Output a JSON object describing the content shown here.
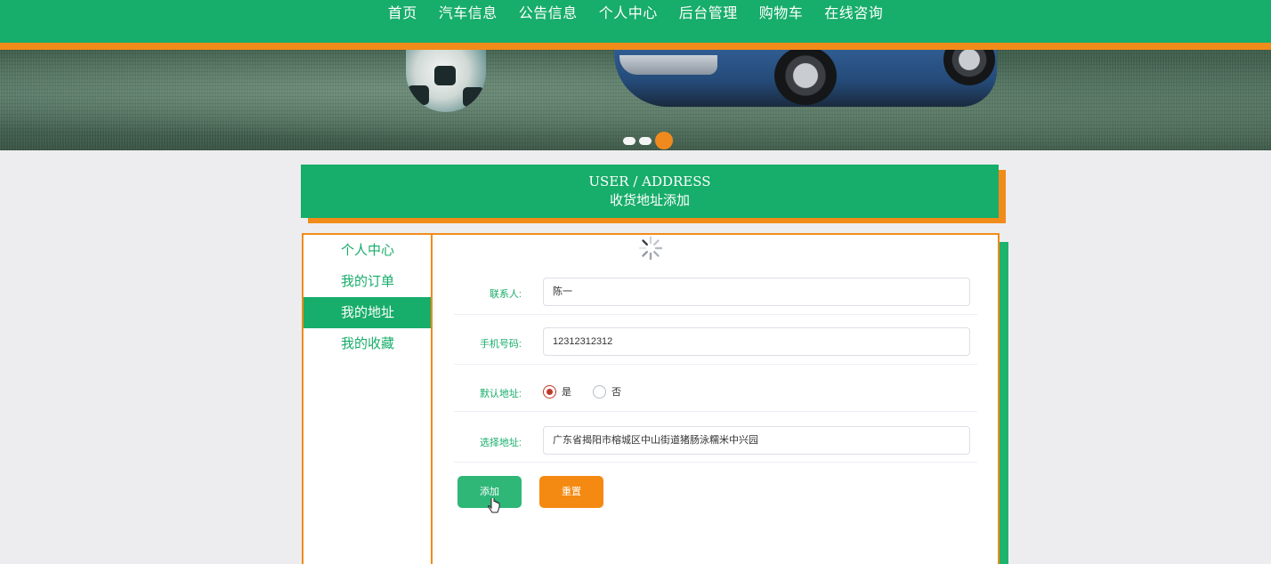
{
  "nav": {
    "items": [
      "首页",
      "汽车信息",
      "公告信息",
      "个人中心",
      "后台管理",
      "购物车",
      "在线咨询"
    ]
  },
  "banner": {
    "slides": 3,
    "active_slide": 3
  },
  "section": {
    "title_en": "USER / ADDRESS",
    "title_cn": "收货地址添加"
  },
  "sidebar": {
    "items": [
      {
        "label": "个人中心",
        "active": false
      },
      {
        "label": "我的订单",
        "active": false
      },
      {
        "label": "我的地址",
        "active": true
      },
      {
        "label": "我的收藏",
        "active": false
      }
    ]
  },
  "form": {
    "contact_label": "联系人:",
    "contact_value": "陈一",
    "phone_label": "手机号码:",
    "phone_value": "12312312312",
    "default_label": "默认地址:",
    "default_yes": "是",
    "default_no": "否",
    "default_selected": "是",
    "address_label": "选择地址:",
    "address_value": "广东省揭阳市榕城区中山街道猪肠泳糯米中兴园",
    "add_button": "添加",
    "reset_button": "重置"
  },
  "colors": {
    "primary": "#17ad6a",
    "accent": "#f18b1a",
    "radio_checked": "#c0392b"
  }
}
